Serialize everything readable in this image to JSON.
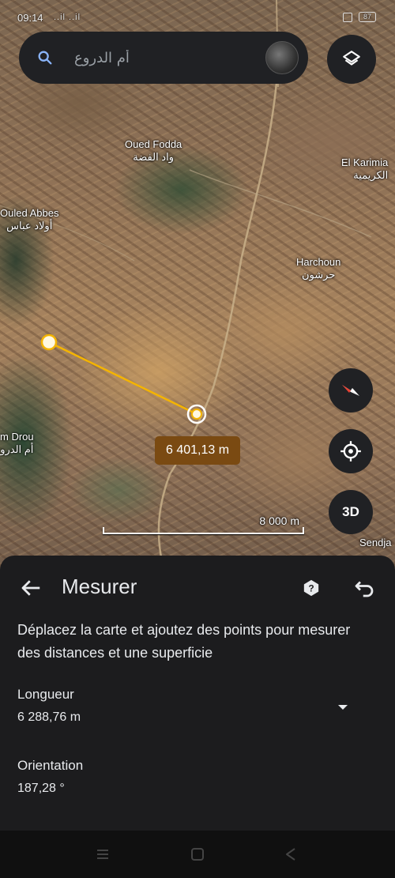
{
  "status_bar": {
    "time": "09:14",
    "signal": "..il ..il",
    "battery": "87"
  },
  "search": {
    "placeholder": "أم الدروع"
  },
  "map": {
    "places": [
      {
        "name": "Oued Fodda",
        "arabic": "واد الفضة"
      },
      {
        "name": "El Karimia",
        "arabic": "الكريمية"
      },
      {
        "name": "Ouled Abbes",
        "arabic": "أولاد عباس"
      },
      {
        "name": "Harchoun",
        "arabic": "حرشون"
      },
      {
        "name": "m Drou",
        "arabic": "أم الدرو"
      },
      {
        "name": "Sendja",
        "arabic": ""
      }
    ],
    "measure_label": "6 401,13 m",
    "scale_label": "8 000 m",
    "button_3d": "3D"
  },
  "panel": {
    "title": "Mesurer",
    "instruction": "Déplacez la carte et ajoutez des points pour mesurer des distances et une superficie",
    "length_label": "Longueur",
    "length_value": "6 288,76 m",
    "orientation_label": "Orientation",
    "orientation_value": "187,28 °"
  },
  "colors": {
    "accent": "#f4b400",
    "measure_label_bg": "#7a4a12",
    "panel_bg": "#1c1c1e",
    "button_bg": "#202124"
  },
  "icons": [
    "search-icon",
    "layers-icon",
    "compass-icon",
    "my-location-icon",
    "back-arrow-icon",
    "help-icon",
    "undo-icon",
    "dropdown-icon"
  ]
}
